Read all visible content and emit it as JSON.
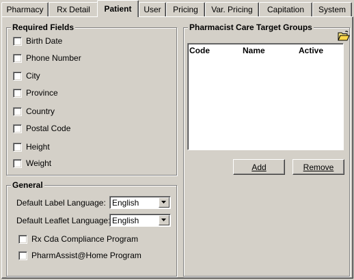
{
  "tabs": [
    {
      "label": "Pharmacy",
      "active": false
    },
    {
      "label": "Rx Detail",
      "active": false
    },
    {
      "label": "Patient",
      "active": true
    },
    {
      "label": "User",
      "active": false
    },
    {
      "label": "Pricing",
      "active": false
    },
    {
      "label": "Var. Pricing",
      "active": false
    },
    {
      "label": "Capitation",
      "active": false
    },
    {
      "label": "System",
      "active": false
    }
  ],
  "required_fields": {
    "title": "Required Fields",
    "items": [
      {
        "label": "Birth Date",
        "checked": false
      },
      {
        "label": "Phone Number",
        "checked": false
      },
      {
        "label": "City",
        "checked": false
      },
      {
        "label": "Province",
        "checked": false
      },
      {
        "label": "Country",
        "checked": false
      },
      {
        "label": "Postal Code",
        "checked": false
      },
      {
        "label": "Height",
        "checked": false
      },
      {
        "label": "Weight",
        "checked": false
      }
    ]
  },
  "general": {
    "title": "General",
    "label_language_label": "Default Label Language:",
    "label_language_value": "English",
    "leaflet_language_label": "Default Leaflet Language:",
    "leaflet_language_value": "English",
    "rx_cda_label": "Rx Cda Compliance Program",
    "rx_cda_checked": false,
    "pharmassist_label": "PharmAssist@Home Program",
    "pharmassist_checked": false
  },
  "care_groups": {
    "title": "Pharmacist Care Target Groups",
    "columns": [
      "Code",
      "Name",
      "Active"
    ],
    "rows": [],
    "add_label": "Add",
    "remove_label": "Remove"
  },
  "icons": {
    "folder": "folder-open-icon",
    "dropdown": "chevron-down-icon"
  }
}
